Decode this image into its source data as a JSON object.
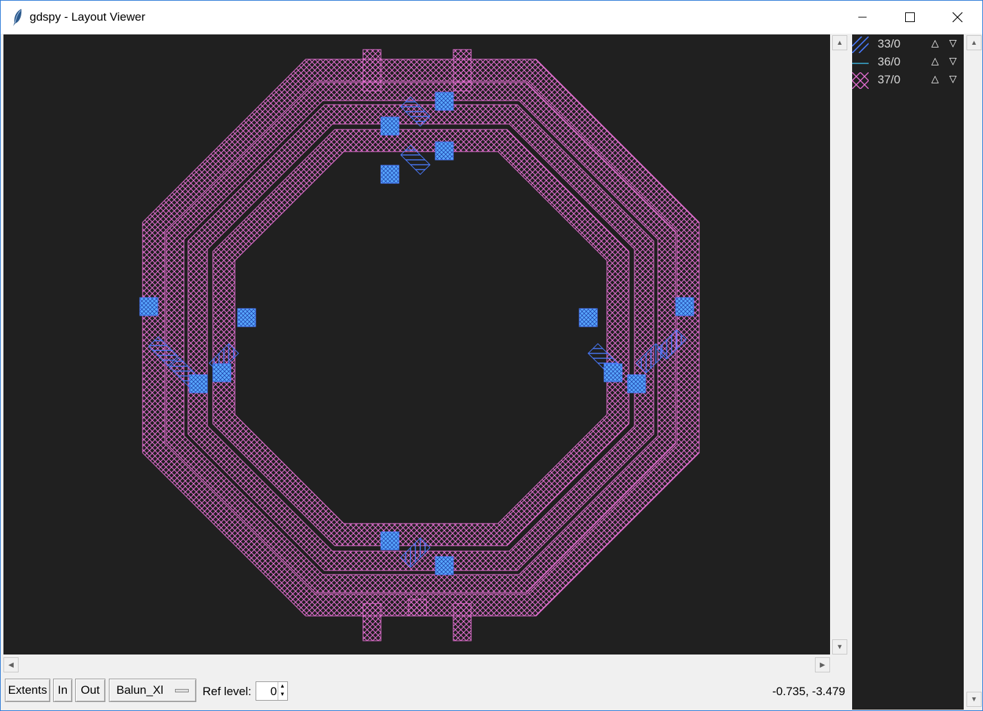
{
  "window": {
    "title": "gdspy - Layout Viewer"
  },
  "layers": [
    {
      "name": "33/0",
      "color": "#4a7bff",
      "pattern": "diagonal"
    },
    {
      "name": "36/0",
      "color": "#3bb0d8",
      "pattern": "horizontal"
    },
    {
      "name": "37/0",
      "color": "#e46fd2",
      "pattern": "crosshatch"
    }
  ],
  "layer_controls": {
    "up": "△",
    "down": "▽"
  },
  "toolbar": {
    "extents": "Extents",
    "zoom_in": "In",
    "zoom_out": "Out",
    "cell": "Balun_Xl",
    "ref_level_label": "Ref level:",
    "ref_level_value": "0"
  },
  "status": {
    "coordinates": "-0.735, -3.479"
  },
  "colors": {
    "canvas_bg": "#202020",
    "metal_pink": "#e46fd2",
    "via_blue": "#4a7bff",
    "via_fill": "#58a8ff"
  }
}
